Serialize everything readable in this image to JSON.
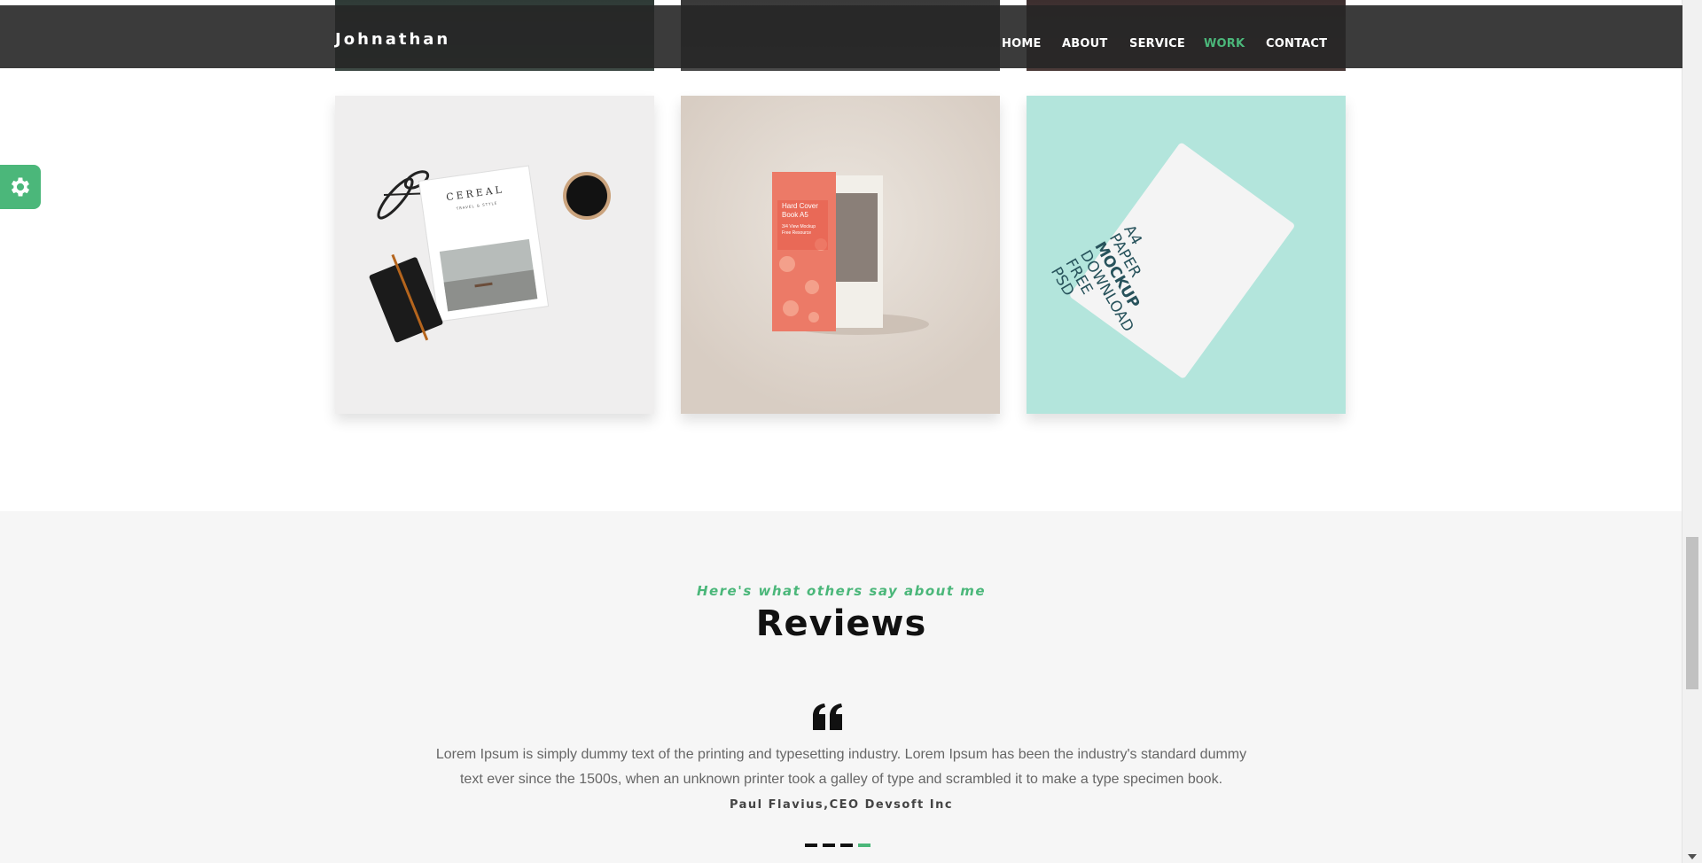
{
  "header": {
    "brand": "Johnathan",
    "nav": [
      {
        "label": "HOME",
        "active": false
      },
      {
        "label": "ABOUT",
        "active": false
      },
      {
        "label": "SERVICE",
        "active": false
      },
      {
        "label": "WORK",
        "active": true
      },
      {
        "label": "CONTACT",
        "active": false
      }
    ]
  },
  "gallery": {
    "tiles": [
      {
        "name": "cereal-magazine-mockup",
        "bg": "#efeeee",
        "magazine_title": "CEREAL",
        "magazine_subtitle": "TRAVEL & STYLE"
      },
      {
        "name": "hard-cover-book-mockup",
        "bg": "#ddd3ca",
        "book_lines": [
          "Hard Cover",
          "Book A5",
          "3/4 View Mockup",
          "Free Resource"
        ]
      },
      {
        "name": "a4-paper-mockup",
        "bg": "#b3e5dc",
        "paper_lines": [
          "A4",
          "PAPER",
          "MOCKUP",
          "DOWNLOAD",
          "FREE",
          "PSD"
        ]
      }
    ]
  },
  "reviews": {
    "subtitle": "Here's what others say about me",
    "title": "Reviews",
    "quote": "Lorem Ipsum is simply dummy text of the printing and typesetting industry. Lorem Ipsum has been the industry's standard dummy text ever since the 1500s, when an unknown printer took a galley of type and scrambled it to make a type specimen book.",
    "author": "Paul Flavius,CEO Devsoft Inc",
    "slide_count": 4,
    "active_slide": 4
  },
  "colors": {
    "accent": "#4bb77a",
    "navbar_bg": "#262626",
    "reviews_bg": "#f6f6f6"
  },
  "icons": {
    "settings": "gear-icon",
    "quote": "quote-left-icon"
  }
}
